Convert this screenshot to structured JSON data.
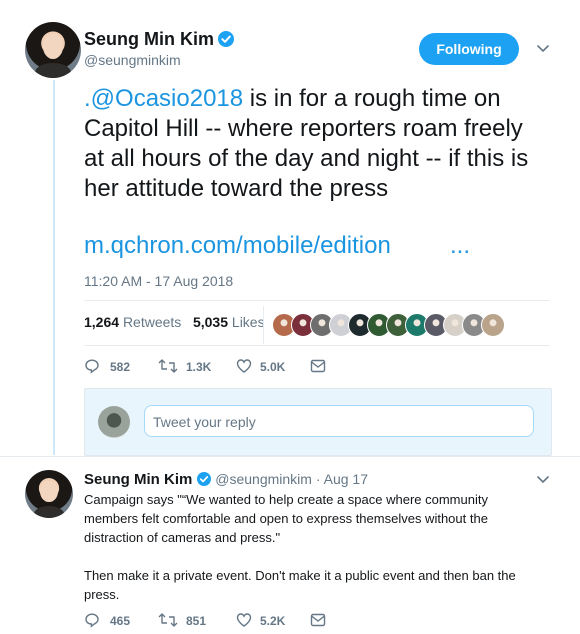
{
  "author": {
    "name": "Seung Min Kim",
    "handle": "@seungminkim"
  },
  "follow_button_label": "Following",
  "tweet": {
    "mention": ".@Ocasio2018",
    "text_after_mention": " is in for a rough time on Capitol Hill -- where reporters roam freely at all hours of the day and night -- if this is her attitude toward the press",
    "link": "m.qchron.com/mobile/edition",
    "link_ellipsis": "...",
    "timestamp": "11:20 AM - 17 Aug 2018",
    "retweets_count": "1,264",
    "retweets_label": "Retweets",
    "likes_count": "5,035",
    "likes_label": "Likes",
    "actions": {
      "replies": "582",
      "retweets": "1.3K",
      "likes": "5.0K"
    }
  },
  "reply_placeholder": "Tweet your reply",
  "reply_tweet": {
    "name": "Seung Min Kim",
    "handle_date": "@seungminkim · Aug 17",
    "paragraph1": "Campaign says \"“We wanted to help create a space where community members felt comfortable and open to express themselves without the distraction of cameras and press.\"",
    "paragraph2": "Then make it a private event. Don't make it a public event and then ban the press.",
    "actions": {
      "replies": "465",
      "retweets": "851",
      "likes": "5.2K"
    }
  },
  "colors": {
    "accent": "#1da1f2",
    "link": "#1b95e0",
    "muted": "#657786",
    "like_avatars": [
      "#b56b4b",
      "#7a2f3a",
      "#6e6e6e",
      "#cfcfd6",
      "#1f2a2e",
      "#2f5a32",
      "#3d5f3a",
      "#1d7a6a",
      "#5a5a66",
      "#d6d0c8",
      "#8a8a8a",
      "#b9a38a"
    ]
  }
}
